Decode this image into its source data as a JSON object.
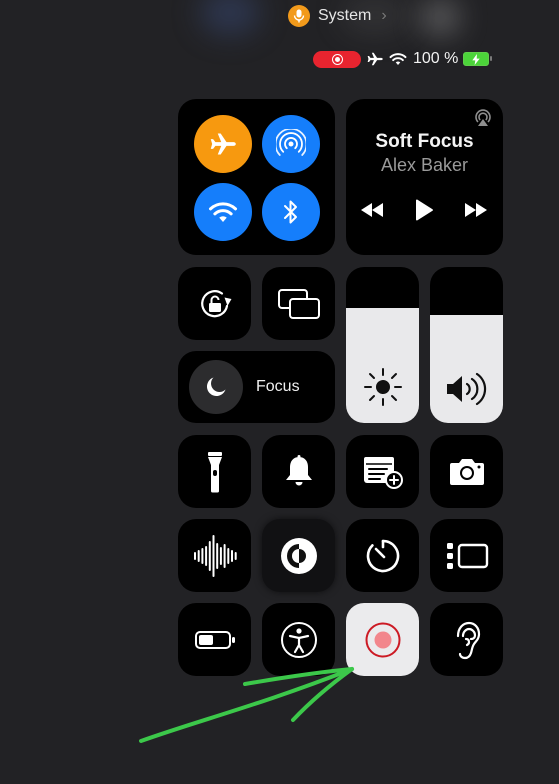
{
  "top_indicator": {
    "app_label": "System",
    "mic_color": "#f29a1b",
    "icon": "microphone-icon"
  },
  "status_bar": {
    "recording_color": "#e8242f",
    "battery_text": "100 %",
    "battery_color": "#4cd43a",
    "airplane_mode": true,
    "wifi": true,
    "charging": true
  },
  "connectivity": {
    "items": [
      {
        "name": "airplane-mode",
        "icon": "airplane-icon",
        "on": true,
        "color": "#f7990f"
      },
      {
        "name": "airdrop",
        "icon": "airdrop-icon",
        "on": true,
        "color": "#157efb"
      },
      {
        "name": "wifi",
        "icon": "wifi-icon",
        "on": true,
        "color": "#157efb"
      },
      {
        "name": "bluetooth",
        "icon": "bluetooth-icon",
        "on": true,
        "color": "#157efb"
      }
    ]
  },
  "now_playing": {
    "title": "Soft Focus",
    "artist": "Alex Baker",
    "controls": [
      "rewind",
      "play",
      "fast-forward"
    ]
  },
  "sliders": {
    "brightness": {
      "level": 0.74,
      "icon": "sun-icon"
    },
    "volume": {
      "level": 0.69,
      "icon": "speaker-icon"
    }
  },
  "focus": {
    "label": "Focus",
    "icon": "moon-icon"
  },
  "tiles": [
    {
      "name": "orientation-lock",
      "icon": "rotation-lock-icon"
    },
    {
      "name": "screen-mirroring",
      "icon": "screen-mirroring-icon"
    },
    {
      "name": "flashlight",
      "icon": "flashlight-icon"
    },
    {
      "name": "silent-mode",
      "icon": "bell-icon"
    },
    {
      "name": "quick-note",
      "icon": "quick-note-icon"
    },
    {
      "name": "camera",
      "icon": "camera-icon"
    },
    {
      "name": "voice-memos",
      "icon": "waveform-icon"
    },
    {
      "name": "dark-mode",
      "icon": "dark-mode-icon"
    },
    {
      "name": "timer",
      "icon": "timer-icon"
    },
    {
      "name": "stage-manager",
      "icon": "stage-manager-icon"
    },
    {
      "name": "low-power-mode",
      "icon": "battery-icon"
    },
    {
      "name": "accessibility-shortcut",
      "icon": "accessibility-icon"
    },
    {
      "name": "screen-recording",
      "icon": "record-icon",
      "active": true
    },
    {
      "name": "hearing",
      "icon": "ear-icon"
    }
  ],
  "annotation": {
    "color": "#3cc84a",
    "points_to": "screen-recording"
  }
}
